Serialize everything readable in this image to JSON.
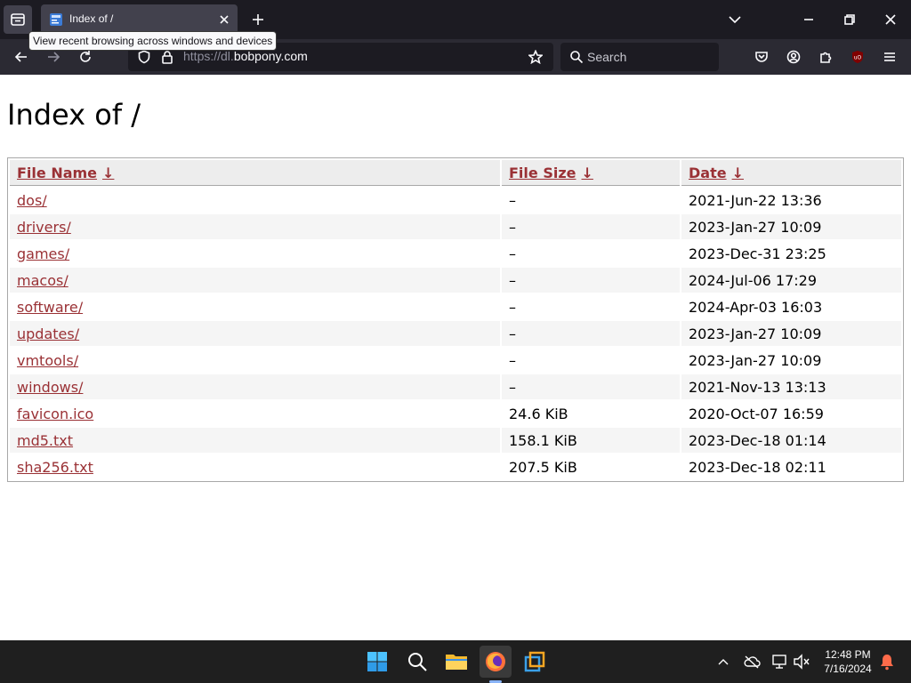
{
  "browser": {
    "tab": {
      "title": "Index of /"
    },
    "tooltip": "View recent browsing across windows and devices",
    "url": {
      "prefix": "https://dl.",
      "domain": "bobpony.com"
    },
    "search_placeholder": "Search"
  },
  "page": {
    "heading": "Index of /",
    "columns": {
      "name": "File Name",
      "size": "File Size",
      "date": "Date",
      "sort_arrow": "↓"
    },
    "rows": [
      {
        "name": "dos/",
        "size": "–",
        "date": "2021-Jun-22 13:36"
      },
      {
        "name": "drivers/",
        "size": "–",
        "date": "2023-Jan-27 10:09"
      },
      {
        "name": "games/",
        "size": "–",
        "date": "2023-Dec-31 23:25"
      },
      {
        "name": "macos/",
        "size": "–",
        "date": "2024-Jul-06 17:29"
      },
      {
        "name": "software/",
        "size": "–",
        "date": "2024-Apr-03 16:03"
      },
      {
        "name": "updates/",
        "size": "–",
        "date": "2023-Jan-27 10:09"
      },
      {
        "name": "vmtools/",
        "size": "–",
        "date": "2023-Jan-27 10:09"
      },
      {
        "name": "windows/",
        "size": "–",
        "date": "2021-Nov-13 13:13"
      },
      {
        "name": "favicon.ico",
        "size": "24.6 KiB",
        "date": "2020-Oct-07 16:59"
      },
      {
        "name": "md5.txt",
        "size": "158.1 KiB",
        "date": "2023-Dec-18 01:14"
      },
      {
        "name": "sha256.txt",
        "size": "207.5 KiB",
        "date": "2023-Dec-18 02:11"
      }
    ]
  },
  "taskbar": {
    "time": "12:48 PM",
    "date": "7/16/2024",
    "apps": [
      "start-icon",
      "search-icon",
      "file-explorer-icon",
      "firefox-icon",
      "vmware-icon"
    ]
  },
  "colors": {
    "link": "#9a3135",
    "chrome_dark": "#1c1b22",
    "toolbar": "#2b2a33"
  }
}
